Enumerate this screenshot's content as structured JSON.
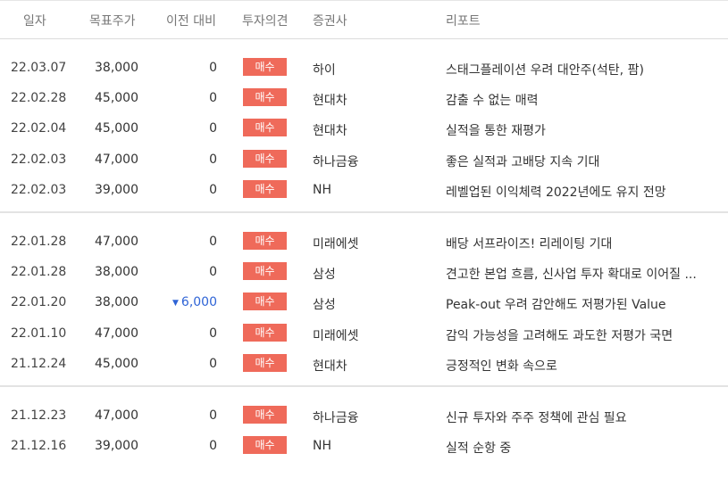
{
  "header": {
    "date": "일자",
    "target": "목표주가",
    "change": "이전 대비",
    "opinion": "투자의견",
    "broker": "증권사",
    "report": "리포트"
  },
  "groups": [
    {
      "rows": [
        {
          "date": "22.03.07",
          "target": "38,000",
          "change": "0",
          "opinion": "매수",
          "broker": "하이",
          "report": "스태그플레이션 우려 대안주(석탄, 팜)"
        },
        {
          "date": "22.02.28",
          "target": "45,000",
          "change": "0",
          "opinion": "매수",
          "broker": "현대차",
          "report": "감출 수 없는 매력"
        },
        {
          "date": "22.02.04",
          "target": "45,000",
          "change": "0",
          "opinion": "매수",
          "broker": "현대차",
          "report": "실적을 통한 재평가"
        },
        {
          "date": "22.02.03",
          "target": "47,000",
          "change": "0",
          "opinion": "매수",
          "broker": "하나금융",
          "report": "좋은 실적과 고배당 지속 기대"
        },
        {
          "date": "22.02.03",
          "target": "39,000",
          "change": "0",
          "opinion": "매수",
          "broker": "NH",
          "report": "레벨업된 이익체력 2022년에도 유지 전망"
        }
      ]
    },
    {
      "rows": [
        {
          "date": "22.01.28",
          "target": "47,000",
          "change": "0",
          "opinion": "매수",
          "broker": "미래에셋",
          "report": "배당 서프라이즈! 리레이팅 기대"
        },
        {
          "date": "22.01.28",
          "target": "38,000",
          "change": "0",
          "opinion": "매수",
          "broker": "삼성",
          "report": "견고한 본업 흐름, 신사업 투자 확대로 이어질 ..."
        },
        {
          "date": "22.01.20",
          "target": "38,000",
          "change": "6,000",
          "direction": "down",
          "opinion": "매수",
          "broker": "삼성",
          "report": "Peak-out 우려 감안해도 저평가된 Value"
        },
        {
          "date": "22.01.10",
          "target": "47,000",
          "change": "0",
          "opinion": "매수",
          "broker": "미래에셋",
          "report": "감익 가능성을 고려해도 과도한 저평가 국면"
        },
        {
          "date": "21.12.24",
          "target": "45,000",
          "change": "0",
          "opinion": "매수",
          "broker": "현대차",
          "report": "긍정적인 변화 속으로"
        }
      ]
    },
    {
      "rows": [
        {
          "date": "21.12.23",
          "target": "47,000",
          "change": "0",
          "opinion": "매수",
          "broker": "하나금융",
          "report": "신규 투자와 주주 정책에 관심 필요"
        },
        {
          "date": "21.12.16",
          "target": "39,000",
          "change": "0",
          "opinion": "매수",
          "broker": "NH",
          "report": "실적 순항 중"
        }
      ]
    }
  ],
  "colors": {
    "buy_badge": "#ef6a5a",
    "down": "#2f64d6"
  },
  "icons": {
    "down_arrow": "▼"
  }
}
